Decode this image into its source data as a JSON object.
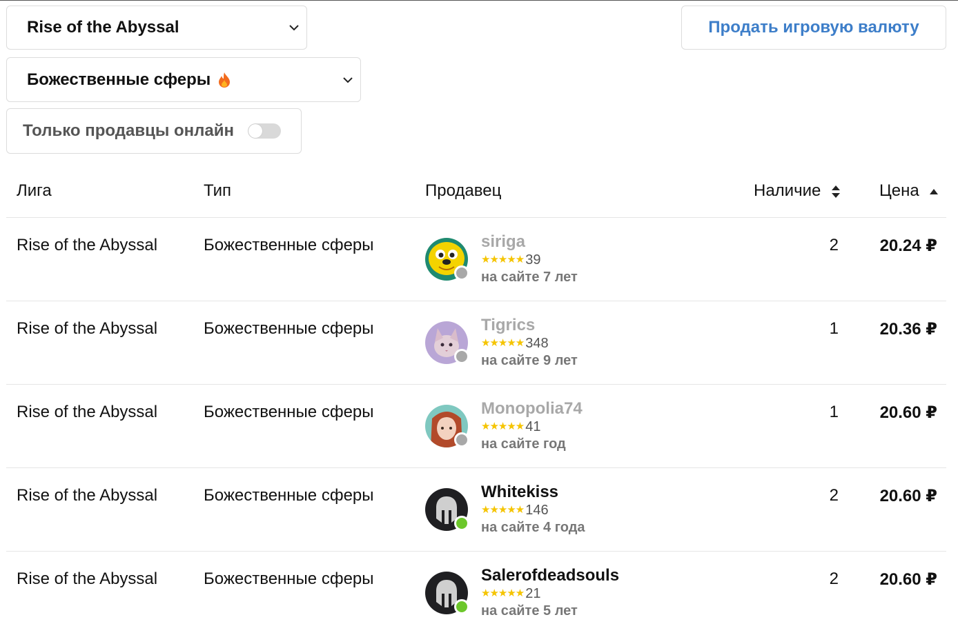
{
  "filters": {
    "game_select": {
      "value": "Rise of the Abyssal"
    },
    "currency_select": {
      "value": "Божественные сферы"
    },
    "online_toggle": {
      "label": "Только продавцы онлайн",
      "checked": false
    },
    "sell_button": {
      "label": "Продать игровую валюту"
    }
  },
  "table": {
    "headers": {
      "league": "Лига",
      "type": "Тип",
      "seller": "Продавец",
      "stock": "Наличие",
      "price": "Цена"
    },
    "rows": [
      {
        "league": "Rise of the Abyssal",
        "type": "Божественные сферы",
        "seller": "siriga",
        "reviews": "39",
        "since": "на сайте 7 лет",
        "online": false,
        "stock": "2",
        "price": "20.24 ₽"
      },
      {
        "league": "Rise of the Abyssal",
        "type": "Божественные сферы",
        "seller": "Tigrics",
        "reviews": "348",
        "since": "на сайте 9 лет",
        "online": false,
        "stock": "1",
        "price": "20.36 ₽"
      },
      {
        "league": "Rise of the Abyssal",
        "type": "Божественные сферы",
        "seller": "Monopolia74",
        "reviews": "41",
        "since": "на сайте год",
        "online": false,
        "stock": "1",
        "price": "20.60 ₽"
      },
      {
        "league": "Rise of the Abyssal",
        "type": "Божественные сферы",
        "seller": "Whitekiss",
        "reviews": "146",
        "since": "на сайте 4 года",
        "online": true,
        "stock": "2",
        "price": "20.60 ₽"
      },
      {
        "league": "Rise of the Abyssal",
        "type": "Божественные сферы",
        "seller": "Salerofdeadsouls",
        "reviews": "21",
        "since": "на сайте 5 лет",
        "online": true,
        "stock": "2",
        "price": "20.60 ₽"
      }
    ]
  },
  "colors": {
    "accent": "#3d7ec9",
    "star": "#f5c400",
    "online": "#6cc72b",
    "offline": "#a8a8a8"
  }
}
